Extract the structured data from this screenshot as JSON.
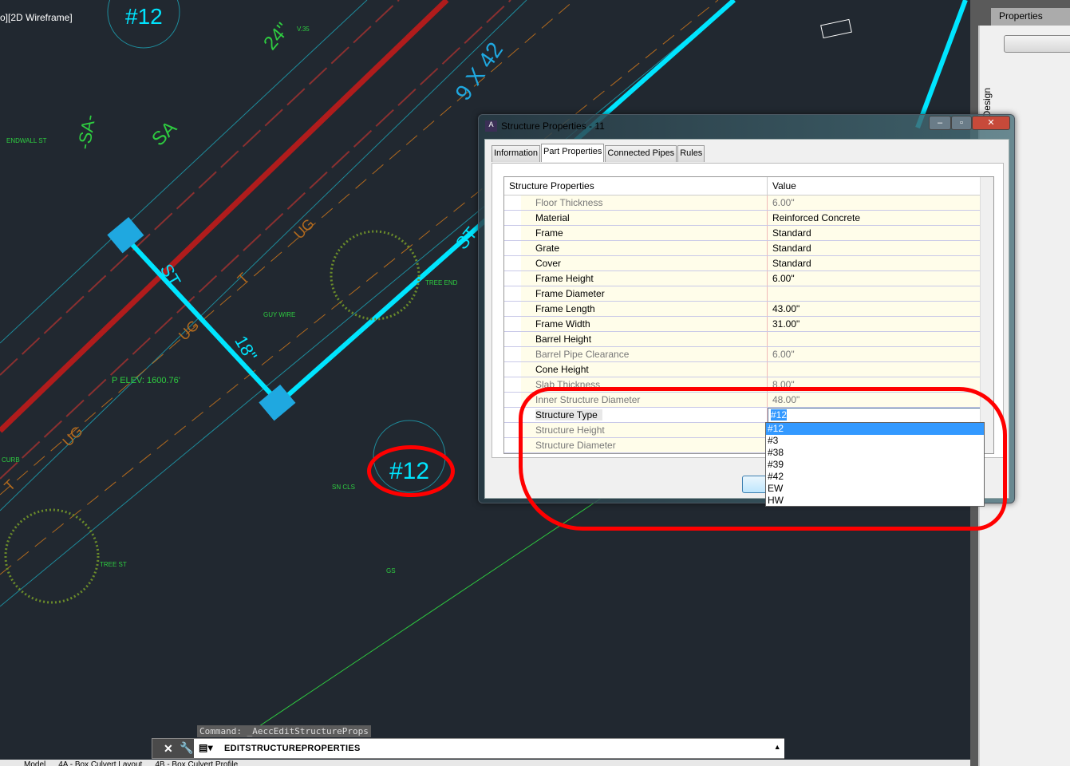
{
  "viewport": {
    "label": "o][2D Wireframe]"
  },
  "cad": {
    "annotation": "#12",
    "labels": [
      "#12",
      "24\"",
      "9 X 42",
      "SA",
      "-SA-",
      "ST",
      "18\"",
      "UG",
      "T",
      "ST",
      "UG",
      "UG",
      "T",
      "P ELEV: 1600.76'",
      "GUY WIRE",
      "TREE END",
      "TREE ST",
      "SN CLS",
      "CURB",
      "ENDWALL ST",
      "GS",
      "V.35"
    ],
    "colors": {
      "background": "#212830",
      "pipe": "#00e5ff",
      "road": "#b01c1c",
      "annotation": "#ff0000"
    }
  },
  "properties_palette": {
    "title": "Properties",
    "side_tab": "Design"
  },
  "dialog": {
    "title": "Structure Properties - 11",
    "tabs": [
      {
        "label": "Information"
      },
      {
        "label": "Part Properties",
        "active": true
      },
      {
        "label": "Connected Pipes"
      },
      {
        "label": "Rules"
      }
    ],
    "grid": {
      "headers": [
        "Structure Properties",
        "Value"
      ],
      "rows": [
        {
          "name": "Floor Thickness",
          "value": "6.00\"",
          "readonly": true
        },
        {
          "name": "Material",
          "value": "Reinforced Concrete"
        },
        {
          "name": "Frame",
          "value": "Standard"
        },
        {
          "name": "Grate",
          "value": "Standard"
        },
        {
          "name": "Cover",
          "value": "Standard"
        },
        {
          "name": "Frame Height",
          "value": "6.00\""
        },
        {
          "name": "Frame Diameter",
          "value": ""
        },
        {
          "name": "Frame Length",
          "value": "43.00\""
        },
        {
          "name": "Frame Width",
          "value": "31.00\""
        },
        {
          "name": "Barrel Height",
          "value": ""
        },
        {
          "name": "Barrel Pipe Clearance",
          "value": "6.00\"",
          "readonly": true
        },
        {
          "name": "Cone Height",
          "value": ""
        },
        {
          "name": "Slab Thickness",
          "value": "8.00\"",
          "readonly": true
        },
        {
          "name": "Inner Structure Diameter",
          "value": "48.00\"",
          "readonly": true
        },
        {
          "name": "Structure Type",
          "value": "#12",
          "selected": true
        },
        {
          "name": "Structure Height",
          "value": "",
          "readonly": true
        },
        {
          "name": "Structure Diameter",
          "value": "",
          "readonly": true
        }
      ]
    },
    "dropdown_options": [
      "#12",
      "#3",
      "#38",
      "#39",
      "#42",
      "EW",
      "HW"
    ],
    "dropdown_selected": "#12"
  },
  "command": {
    "history": "Command:  _AeccEditStructureProps",
    "input": "EDITSTRUCTUREPROPERTIES"
  },
  "layout_tabs": [
    "Model",
    "4A - Box Culvert Layout",
    "4B - Box Culvert Profile"
  ]
}
